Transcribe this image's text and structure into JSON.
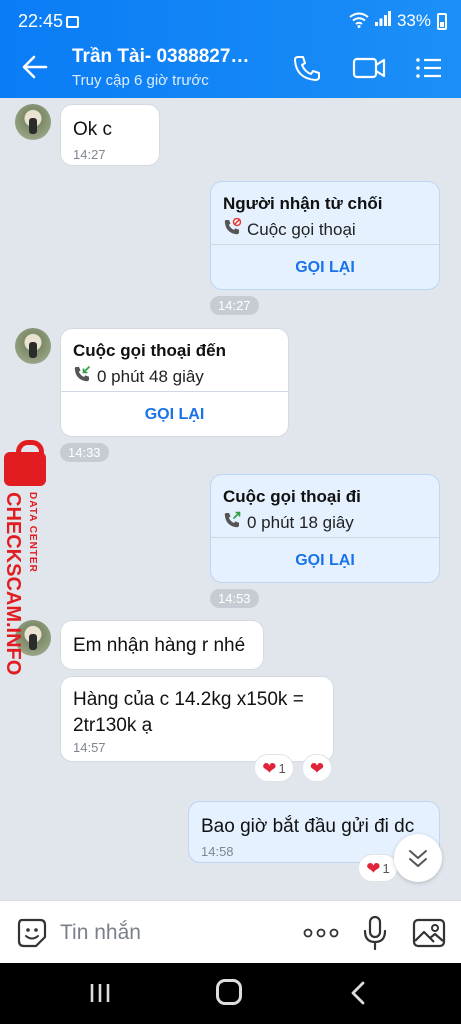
{
  "status_bar": {
    "time": "22:45",
    "battery": "33%"
  },
  "header": {
    "title": "Trần Tài- 0388827…",
    "subtitle": "Truy cập 6 giờ trước"
  },
  "messages": [
    {
      "text": "Ok c",
      "time": "14:27"
    },
    {
      "call_title": "Người nhận từ chối",
      "call_sub": "Cuộc gọi thoại",
      "button": "GỌI LẠI",
      "time": "14:27"
    },
    {
      "call_title": "Cuộc gọi thoại đến",
      "call_sub": "0 phút 48 giây",
      "button": "GỌI LẠI",
      "time": "14:33"
    },
    {
      "call_title": "Cuộc gọi thoại đi",
      "call_sub": "0 phút 18 giây",
      "button": "GỌI LẠI",
      "time": "14:53"
    },
    {
      "text": "Em nhận hàng r nhé"
    },
    {
      "text": "Hàng của c 14.2kg x150k = 2tr130k ạ",
      "time": "14:57",
      "reaction_count": "1"
    },
    {
      "text": "Bao giờ bắt đầu gửi đi dc",
      "time": "14:58",
      "reaction_count": "1"
    }
  ],
  "watermark": {
    "big": "CHECKSCAM.INFO",
    "small": "DATA CENTER"
  },
  "input": {
    "placeholder": "Tin nhắn"
  },
  "colors": {
    "header": "#0a7cf6",
    "accent": "#1a73e8",
    "reaction": "#e0243a",
    "watermark": "#e11d22"
  }
}
